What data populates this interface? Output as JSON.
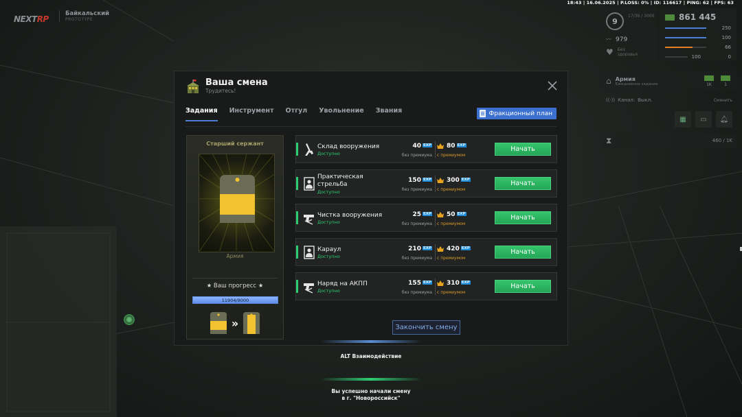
{
  "status_bar": "18:43 | 16.06.2025 | P.LOSS: 0% | ID: 116617 | PING: 62 | FPS: 63",
  "brand": {
    "logo_left": "NEXT",
    "logo_right": "RP",
    "server": "Байкальский",
    "server_sub": "PROTOTYPE"
  },
  "hud": {
    "level": "9",
    "xp": "17/36 / 3000",
    "damage": "979",
    "heart_label": "Без",
    "heart_sub": "здоровья",
    "money": "861 445",
    "stats": [
      {
        "value": "250",
        "color": "#4a7fd6",
        "fill": 1.0
      },
      {
        "value": "100",
        "color": "#4a7fd6",
        "fill": 1.0
      },
      {
        "value": "66",
        "color": "#e67e22",
        "fill": 0.66
      },
      {
        "value": "0",
        "color": "#555555",
        "fill": 0.0
      }
    ],
    "stats_extra": "100",
    "job_title": "Армия",
    "job_sub": "Ежедневное задание",
    "cash1": "1K",
    "cash2": "1",
    "channel_label": "Канал:",
    "channel_value": "Выкл.",
    "channel_switch": "Сменить",
    "timer_value": "460 / 1K"
  },
  "modal": {
    "title": "Ваша смена",
    "subtitle": "Трудитесь!",
    "tabs": [
      {
        "label": "Задания",
        "active": true
      },
      {
        "label": "Инструмент",
        "active": false
      },
      {
        "label": "Отгул",
        "active": false
      },
      {
        "label": "Увольнение",
        "active": false
      },
      {
        "label": "Звания",
        "active": false
      }
    ],
    "fraction_button": "Фракционный план",
    "rank": {
      "name": "Старший сержант",
      "faction": "Армия",
      "progress_label": "★ Ваш прогресс ★",
      "progress_text": "11904/9000",
      "progress_fraction": 1.0
    },
    "exp_tag": "EXP",
    "sub_base": "без премиума",
    "sub_prem": "с премиумом",
    "start_label": "Начать",
    "tasks": [
      {
        "name": "Склад вооружения",
        "status": "Доступно",
        "base": "40",
        "prem": "80",
        "icon": "rifle-icon"
      },
      {
        "name": "Практическая стрельба",
        "status": "Доступно",
        "base": "150",
        "prem": "300",
        "icon": "target-icon"
      },
      {
        "name": "Чистка вооружения",
        "status": "Доступно",
        "base": "25",
        "prem": "50",
        "icon": "pistol-icon"
      },
      {
        "name": "Караул",
        "status": "Доступно",
        "base": "210",
        "prem": "420",
        "icon": "target-icon"
      },
      {
        "name": "Наряд на АКПП",
        "status": "Доступно",
        "base": "155",
        "prem": "310",
        "icon": "pistol-icon"
      }
    ],
    "finish_button": "Закончить смену"
  },
  "hints": {
    "interaction": "ALT Взаимодействие",
    "notification_line1": "Вы успешно начали смену",
    "notification_line2": "в г. \"Новороссийск\""
  }
}
